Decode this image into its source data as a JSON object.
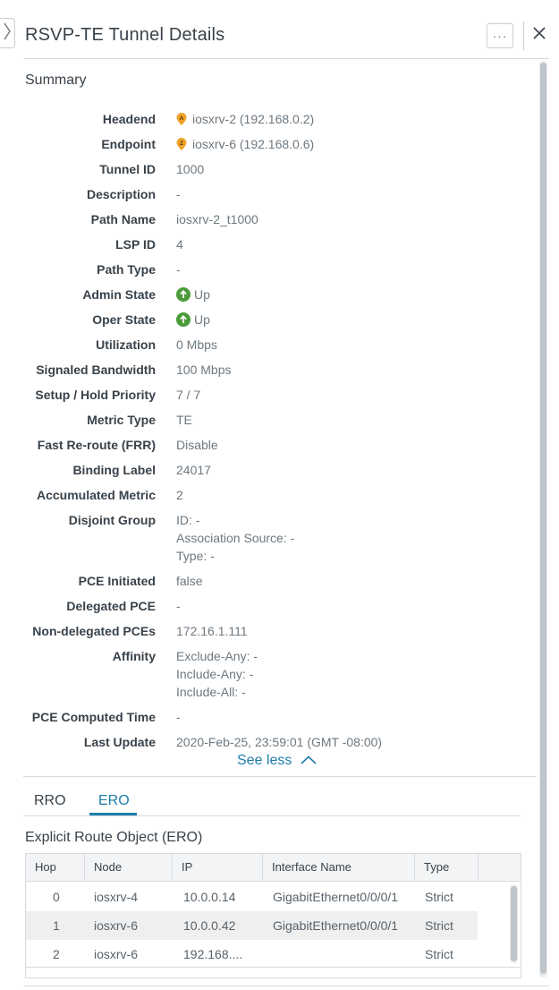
{
  "panel": {
    "title": "RSVP-TE Tunnel Details",
    "more_label": "···"
  },
  "summary": {
    "title": "Summary",
    "see_less": "See less",
    "fields": {
      "headend": {
        "label": "Headend",
        "value": "iosxrv-2 (192.168.0.2)",
        "badge": "A"
      },
      "endpoint": {
        "label": "Endpoint",
        "value": "iosxrv-6 (192.168.0.6)",
        "badge": "Z"
      },
      "tunnel_id": {
        "label": "Tunnel ID",
        "value": "1000"
      },
      "description": {
        "label": "Description",
        "value": "-"
      },
      "path_name": {
        "label": "Path Name",
        "value": "iosxrv-2_t1000"
      },
      "lsp_id": {
        "label": "LSP ID",
        "value": "4"
      },
      "path_type": {
        "label": "Path Type",
        "value": "-"
      },
      "admin_state": {
        "label": "Admin State",
        "value": "Up"
      },
      "oper_state": {
        "label": "Oper State",
        "value": "Up"
      },
      "utilization": {
        "label": "Utilization",
        "value": "0 Mbps"
      },
      "signaled_bw": {
        "label": "Signaled Bandwidth",
        "value": "100 Mbps"
      },
      "priority": {
        "label": "Setup / Hold Priority",
        "value": "7 / 7"
      },
      "metric_type": {
        "label": "Metric Type",
        "value": "TE"
      },
      "frr": {
        "label": "Fast Re-route (FRR)",
        "value": "Disable"
      },
      "binding_label": {
        "label": "Binding Label",
        "value": "24017"
      },
      "acc_metric": {
        "label": "Accumulated Metric",
        "value": "2"
      },
      "disjoint": {
        "label": "Disjoint Group",
        "lines": [
          "ID: -",
          "Association Source: -",
          "Type: -"
        ]
      },
      "pce_initiated": {
        "label": "PCE Initiated",
        "value": "false"
      },
      "delegated_pce": {
        "label": "Delegated PCE",
        "value": "-"
      },
      "non_delegated": {
        "label": "Non-delegated PCEs",
        "value": "172.16.1.111"
      },
      "affinity": {
        "label": "Affinity",
        "lines": [
          "Exclude-Any: -",
          "Include-Any: -",
          "Include-All: -"
        ]
      },
      "pce_time": {
        "label": "PCE Computed Time",
        "value": "-"
      },
      "last_update": {
        "label": "Last Update",
        "value": "2020-Feb-25, 23:59:01 (GMT -08:00)"
      }
    }
  },
  "tabs": {
    "rro": "RRO",
    "ero": "ERO",
    "active": "ERO"
  },
  "ero": {
    "title": "Explicit Route Object (ERO)",
    "columns": {
      "hop": "Hop",
      "node": "Node",
      "ip": "IP",
      "iface": "Interface Name",
      "type": "Type"
    },
    "rows": [
      {
        "hop": "0",
        "node": "iosxrv-4",
        "ip": "10.0.0.14",
        "iface": "GigabitEthernet0/0/0/1",
        "type": "Strict"
      },
      {
        "hop": "1",
        "node": "iosxrv-6",
        "ip": "10.0.0.42",
        "iface": "GigabitEthernet0/0/0/1",
        "type": "Strict"
      },
      {
        "hop": "2",
        "node": "iosxrv-6",
        "ip": "192.168....",
        "iface": "",
        "type": "Strict"
      }
    ]
  },
  "colors": {
    "accent": "#1e7dab",
    "up_green": "#4a9b3a",
    "pin_orange": "#f0a22b"
  }
}
